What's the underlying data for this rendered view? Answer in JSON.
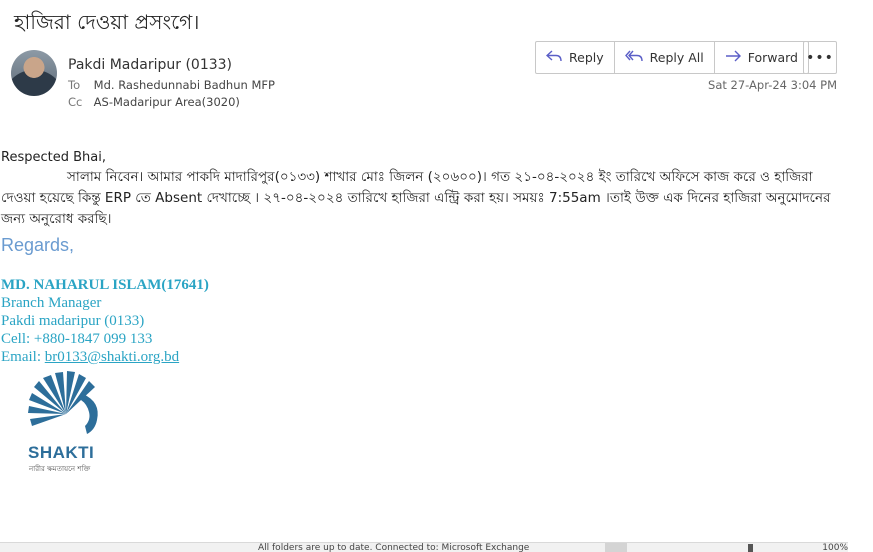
{
  "subject": "হাজিরা দেওয়া প্রসংগে।",
  "sender": {
    "name": "Pakdi Madaripur (0133)"
  },
  "to": {
    "label": "To",
    "value": "Md. Rashedunnabi Badhun MFP"
  },
  "cc": {
    "label": "Cc",
    "value": "AS-Madaripur Area(3020)"
  },
  "actions": {
    "reply": "Reply",
    "reply_all": "Reply All",
    "forward": "Forward",
    "more": "•••"
  },
  "datetime": "Sat 27-Apr-24 3:04 PM",
  "body": {
    "greeting": "Respected Bhai,",
    "paragraph": "সালাম নিবেন। আমার পাকদি মাদারিপুর(০১৩৩) শাখার মোঃ জিলন (২০৬০০)। গত ২১-০৪-২০২৪ ইং তারিখে অফিসে কাজ করে ও হাজিরা দেওয়া হয়েছে কিন্তু ERP তে Absent দেখাচ্ছে । ২৭-০৪-২০২৪ তারিখে হাজিরা এন্ট্রি করা হয়। সময়ঃ 7:55am ।তাই উক্ত এক দিনের হাজিরা অনুমোদনের জন্য অনুরোধ করছি।",
    "regards": "Regards,"
  },
  "signature": {
    "name": "MD. NAHARUL ISLAM(17641)",
    "title": "Branch Manager",
    "branch": "Pakdi madaripur (0133)",
    "cell": "Cell: +880-1847 099 133",
    "email_label": "Email: ",
    "email": "br0133@shakti.org.bd"
  },
  "logo": {
    "text": "SHAKTI",
    "tagline": "নারীর ক্ষমতায়নে শক্তি"
  },
  "statusbar": {
    "text": "All folders are up to date.   Connected to: Microsoft Exchange",
    "zoom": "100%"
  },
  "colors": {
    "accent": "#5b5fc7",
    "signature": "#2aa4c4",
    "regards": "#6a9bd0",
    "logo": "#2d6e9a"
  }
}
